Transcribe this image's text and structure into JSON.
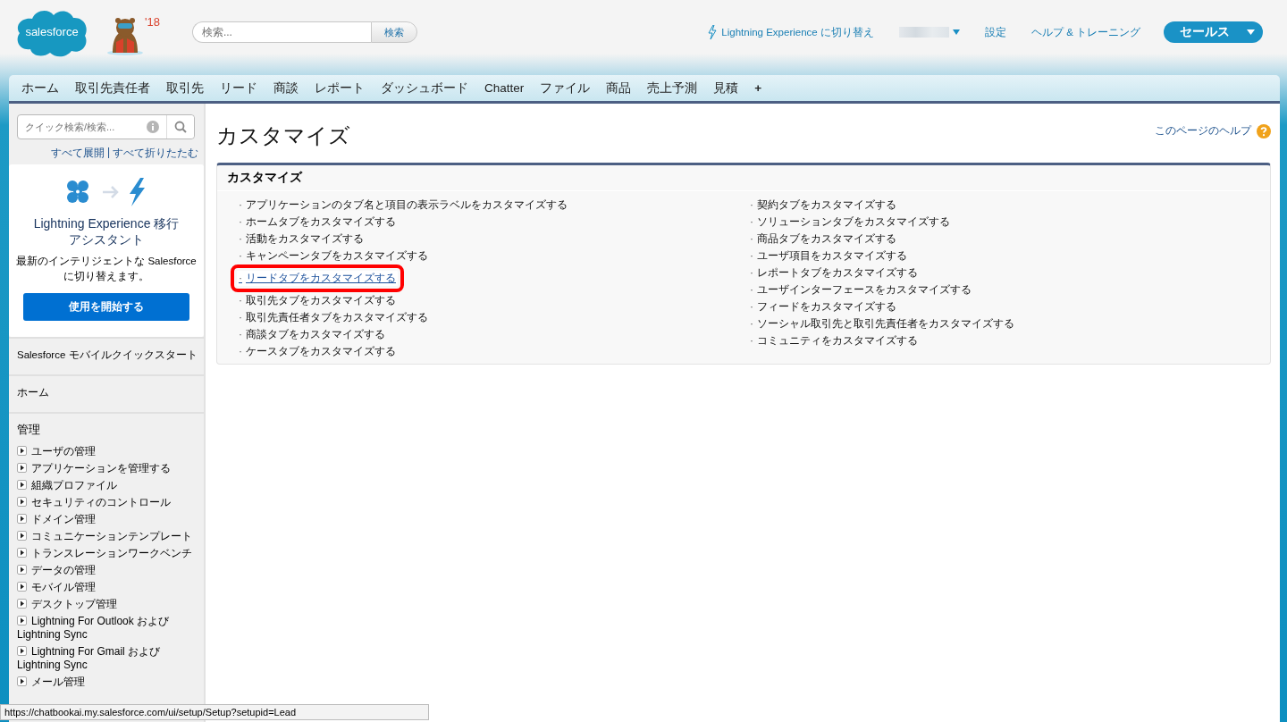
{
  "header": {
    "logo": "salesforce",
    "mascot_year": "'18",
    "search": {
      "placeholder": "検索...",
      "button": "検索"
    },
    "links": [
      {
        "kind": "lightning",
        "label": "Lightning Experience に切り替え"
      },
      {
        "kind": "user"
      },
      {
        "kind": "plain",
        "label": "設定"
      },
      {
        "kind": "plain",
        "label": "ヘルプ & トレーニング"
      }
    ],
    "app_menu": "セールス"
  },
  "tabs": [
    {
      "label": "ホーム"
    },
    {
      "label": "取引先責任者"
    },
    {
      "label": "取引先"
    },
    {
      "label": "リード"
    },
    {
      "label": "商談"
    },
    {
      "label": "レポート"
    },
    {
      "label": "ダッシュボード"
    },
    {
      "label": "Chatter"
    },
    {
      "label": "ファイル"
    },
    {
      "label": "商品"
    },
    {
      "label": "売上予測"
    },
    {
      "label": "見積"
    },
    {
      "label": "+"
    }
  ],
  "sidebar": {
    "search": {
      "placeholder": "クイック検索/検索..."
    },
    "expand_all": "すべて展開",
    "separator": "|",
    "collapse_all": "すべて折りたたむ",
    "promo": {
      "title": "Lightning Experience 移行アシスタント",
      "text": "最新のインテリジェントな Salesforce に切り替えます。",
      "button": "使用を開始する"
    },
    "sections": [
      {
        "label": "Salesforce モバイルクイックスタート"
      },
      {
        "label": "ホーム"
      }
    ],
    "admin": {
      "title": "管理",
      "items": [
        {
          "label": "ユーザの管理",
          "expanded": false
        },
        {
          "label": "アプリケーションを管理する",
          "expanded": false
        },
        {
          "label": "組織プロファイル",
          "expanded": false
        },
        {
          "label": "セキュリティのコントロール",
          "expanded": false
        },
        {
          "label": "ドメイン管理",
          "expanded": false
        },
        {
          "label": "コミュニケーションテンプレート",
          "expanded": false
        },
        {
          "label": "トランスレーションワークベンチ",
          "expanded": false
        },
        {
          "label": "データの管理",
          "expanded": false
        },
        {
          "label": "モバイル管理",
          "expanded": false
        },
        {
          "label": "デスクトップ管理",
          "expanded": false
        },
        {
          "label": "Lightning For Outlook および Lightning Sync",
          "expanded": false
        },
        {
          "label": "Lightning For Gmail および Lightning Sync",
          "expanded": false
        },
        {
          "label": "メール管理",
          "expanded": false
        }
      ]
    }
  },
  "page": {
    "title": "カスタマイズ",
    "help": "このページのヘルプ",
    "section_title": "カスタマイズ",
    "bullet": "·",
    "columns": [
      [
        {
          "label": "アプリケーションのタブ名と項目の表示ラベルをカスタマイズする",
          "highlighted": false
        },
        {
          "label": "ホームタブをカスタマイズする",
          "highlighted": false
        },
        {
          "label": "活動をカスタマイズする",
          "highlighted": false
        },
        {
          "label": "キャンペーンタブをカスタマイズする",
          "highlighted": false
        },
        {
          "label": "リードタブをカスタマイズする",
          "highlighted": true
        },
        {
          "label": "取引先タブをカスタマイズする",
          "highlighted": false
        },
        {
          "label": "取引先責任者タブをカスタマイズする",
          "highlighted": false
        },
        {
          "label": "商談タブをカスタマイズする",
          "highlighted": false
        },
        {
          "label": "ケースタブをカスタマイズする",
          "highlighted": false
        }
      ],
      [
        {
          "label": "契約タブをカスタマイズする",
          "highlighted": false
        },
        {
          "label": "ソリューションタブをカスタマイズする",
          "highlighted": false
        },
        {
          "label": "商品タブをカスタマイズする",
          "highlighted": false
        },
        {
          "label": "ユーザ項目をカスタマイズする",
          "highlighted": false
        },
        {
          "label": "レポートタブをカスタマイズする",
          "highlighted": false
        },
        {
          "label": "ユーザインターフェースをカスタマイズする",
          "highlighted": false
        },
        {
          "label": "フィードをカスタマイズする",
          "highlighted": false
        },
        {
          "label": "ソーシャル取引先と取引先責任者をカスタマイズする",
          "highlighted": false
        },
        {
          "label": "コミュニティをカスタマイズする",
          "highlighted": false
        }
      ]
    ]
  },
  "status_bar": {
    "url": "https://chatbookai.my.salesforce.com/ui/setup/Setup?setupid=Lead"
  }
}
